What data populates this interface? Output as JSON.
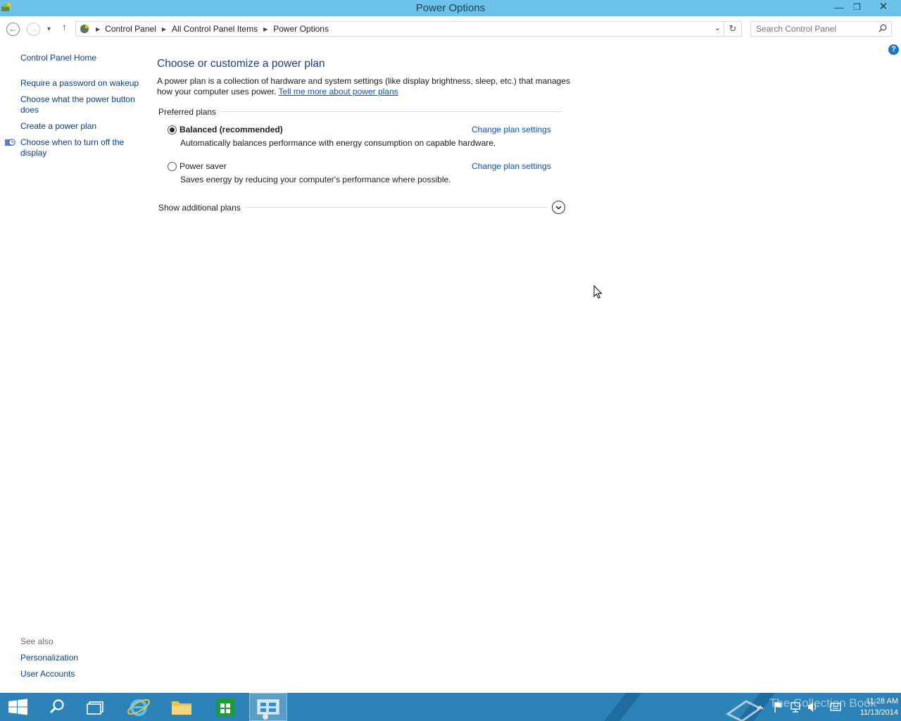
{
  "window": {
    "title": "Power Options",
    "minimize_glyph": "—",
    "maximize_glyph": "❐",
    "close_glyph": "✕"
  },
  "navigation": {
    "back_glyph": "←",
    "forward_glyph": "→",
    "recent_glyph": "▾",
    "up_glyph": "↑",
    "breadcrumbs": [
      "Control Panel",
      "All Control Panel Items",
      "Power Options"
    ],
    "separator_glyph": "▶",
    "address_dropdown_glyph": "⌄",
    "refresh_glyph": "↻",
    "search_placeholder": "Search Control Panel"
  },
  "help_glyph": "?",
  "left_pane": {
    "home": "Control Panel Home",
    "items": [
      "Require a password on wakeup",
      "Choose what the power button does",
      "Create a power plan",
      "Choose when to turn off the display"
    ],
    "see_also_label": "See also",
    "see_also_links": [
      "Personalization",
      "User Accounts"
    ]
  },
  "main": {
    "title": "Choose or customize a power plan",
    "description": "A power plan is a collection of hardware and system settings (like display brightness, sleep, etc.) that manages how your computer uses power.",
    "learn_more_link": "Tell me more about power plans",
    "preferred_plans_label": "Preferred plans",
    "plans": [
      {
        "name": "Balanced (recommended)",
        "description": "Automatically balances performance with energy consumption on capable hardware.",
        "selected": true,
        "change_link": "Change plan settings"
      },
      {
        "name": "Power saver",
        "description": "Saves energy by reducing your computer's performance where possible.",
        "selected": false,
        "change_link": "Change plan settings"
      }
    ],
    "show_additional_label": "Show additional plans"
  },
  "taskbar": {
    "watermark": "The Collection Book",
    "time": "11:28 AM",
    "date": "11/13/2014",
    "accent": "#2b83b7"
  },
  "colors": {
    "titlebar": "#6dc2e9",
    "heading_blue": "#1e3d8c",
    "link_blue": "#0a53be"
  }
}
